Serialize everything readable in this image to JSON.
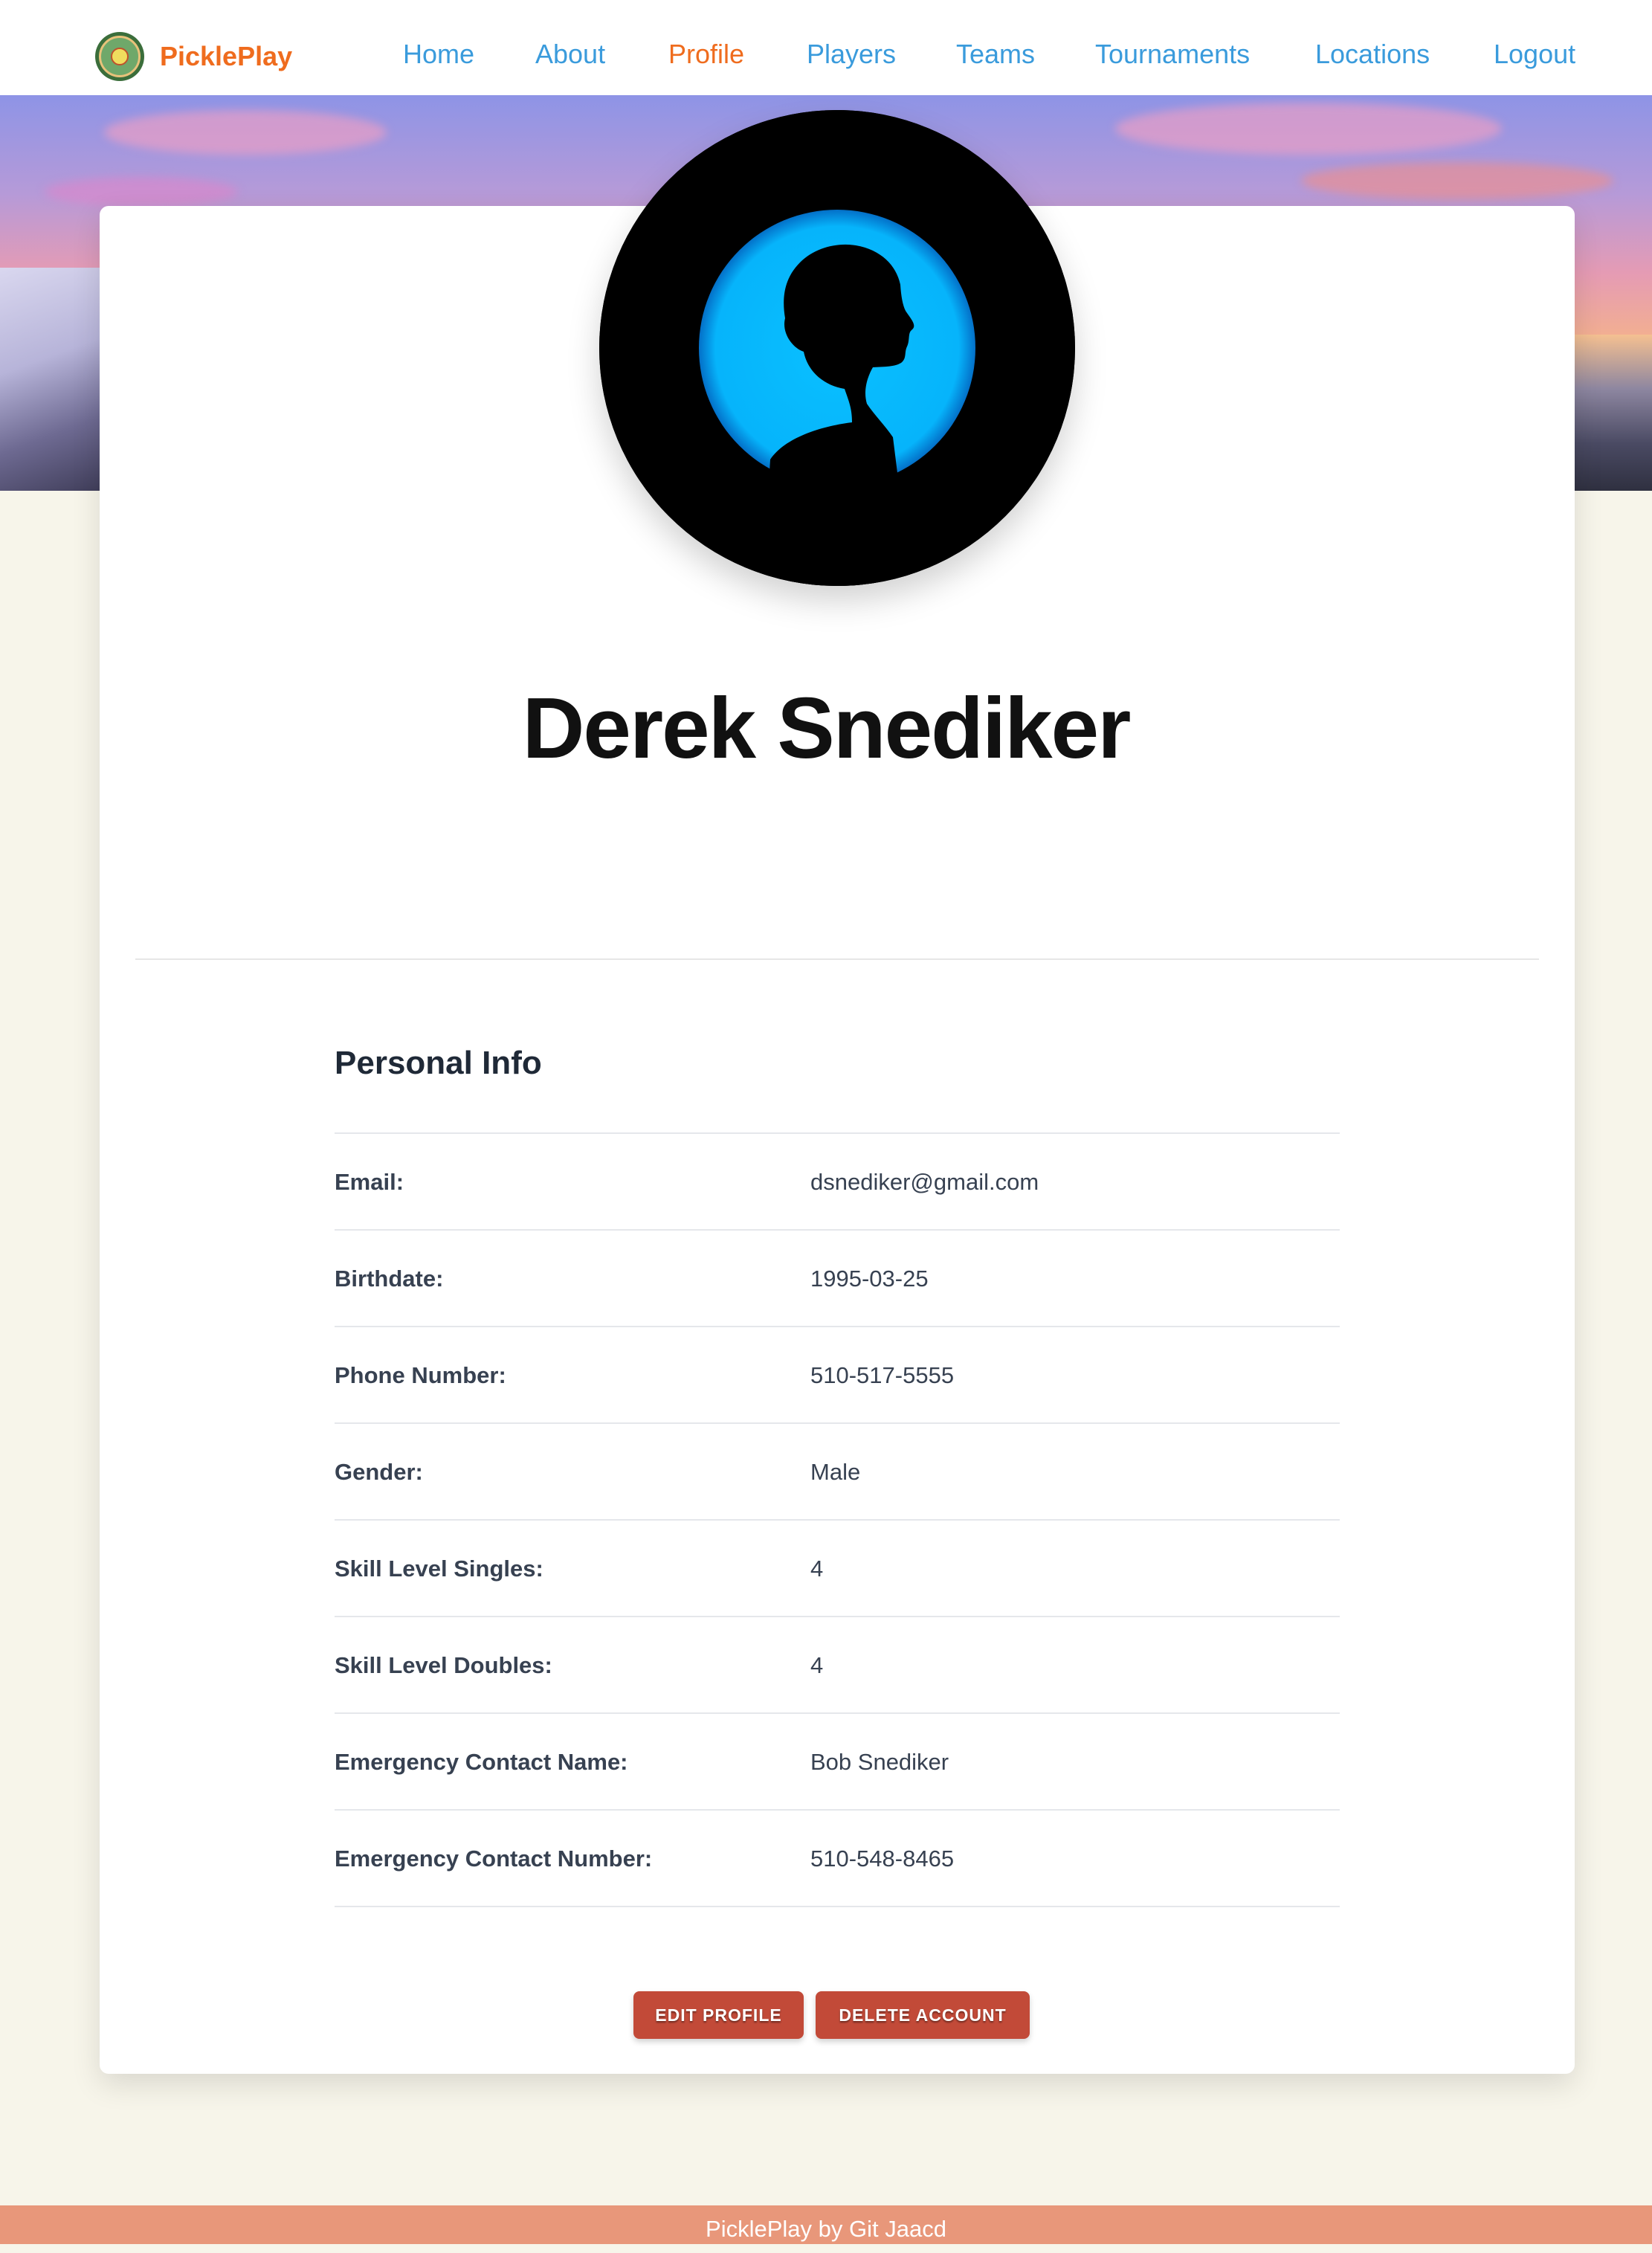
{
  "brand": {
    "name": "PicklePlay"
  },
  "nav": {
    "items": [
      {
        "label": "Home"
      },
      {
        "label": "About"
      },
      {
        "label": "Profile",
        "active": true
      },
      {
        "label": "Players"
      },
      {
        "label": "Teams"
      },
      {
        "label": "Tournaments"
      },
      {
        "label": "Locations"
      },
      {
        "label": "Logout"
      }
    ]
  },
  "profile": {
    "name": "Derek Snediker",
    "section_title": "Personal Info",
    "fields": [
      {
        "label": "Email:",
        "value": "dsnediker@gmail.com"
      },
      {
        "label": "Birthdate:",
        "value": "1995-03-25"
      },
      {
        "label": "Phone Number:",
        "value": "510-517-5555"
      },
      {
        "label": "Gender:",
        "value": "Male"
      },
      {
        "label": "Skill Level Singles:",
        "value": "4"
      },
      {
        "label": "Skill Level Doubles:",
        "value": "4"
      },
      {
        "label": "Emergency Contact Name:",
        "value": "Bob Snediker"
      },
      {
        "label": "Emergency Contact Number:",
        "value": "510-548-8465"
      }
    ]
  },
  "actions": {
    "edit_label": "EDIT PROFILE",
    "delete_label": "DELETE ACCOUNT"
  },
  "footer": {
    "text": "PicklePlay by Git Jaacd"
  },
  "colors": {
    "brand_orange": "#ef6c1e",
    "nav_link_blue": "#3a9bdc",
    "button_red": "#c24a38",
    "footer_salmon": "#e8977a",
    "page_background": "#f7f5ea",
    "avatar_ring_blue": "#06b4fb"
  },
  "icons": {
    "brand_logo": "pickleball-logo-icon",
    "avatar": "silhouette-avatar"
  }
}
